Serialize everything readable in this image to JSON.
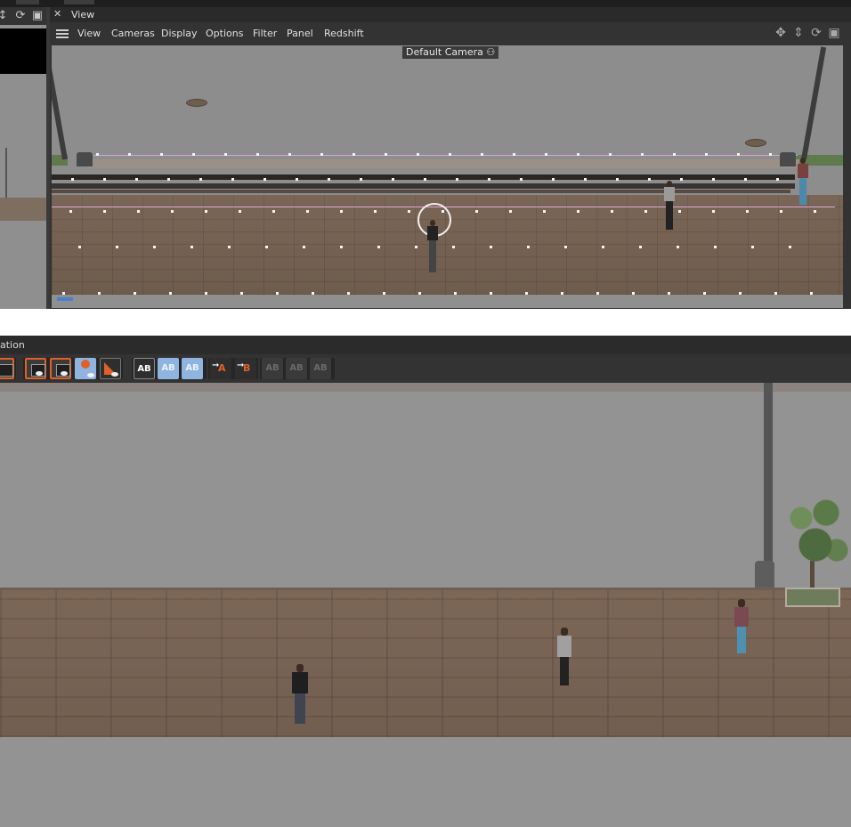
{
  "view_panel": {
    "title": "View",
    "menu": [
      "View",
      "Cameras",
      "Display",
      "Options",
      "Filter",
      "Panel",
      "Redshift"
    ],
    "nav_icons": [
      "move-icon",
      "zoom-icon",
      "rotate-icon",
      "maximize-icon"
    ],
    "camera_label": "Default Camera"
  },
  "left_panel": {
    "icons": [
      "move-icon",
      "rotate-icon",
      "maximize-icon"
    ]
  },
  "render_window": {
    "title": "ation",
    "toolbar_labels": {
      "ab": "AB",
      "a": "A",
      "b": "B"
    }
  },
  "colors": {
    "accent_orange": "#e0602a",
    "selected_blue": "#8fb4e0",
    "panel_dark": "#333333",
    "viewport_gray": "#8d8d8d",
    "selection_pink": "#d9a6d6"
  }
}
